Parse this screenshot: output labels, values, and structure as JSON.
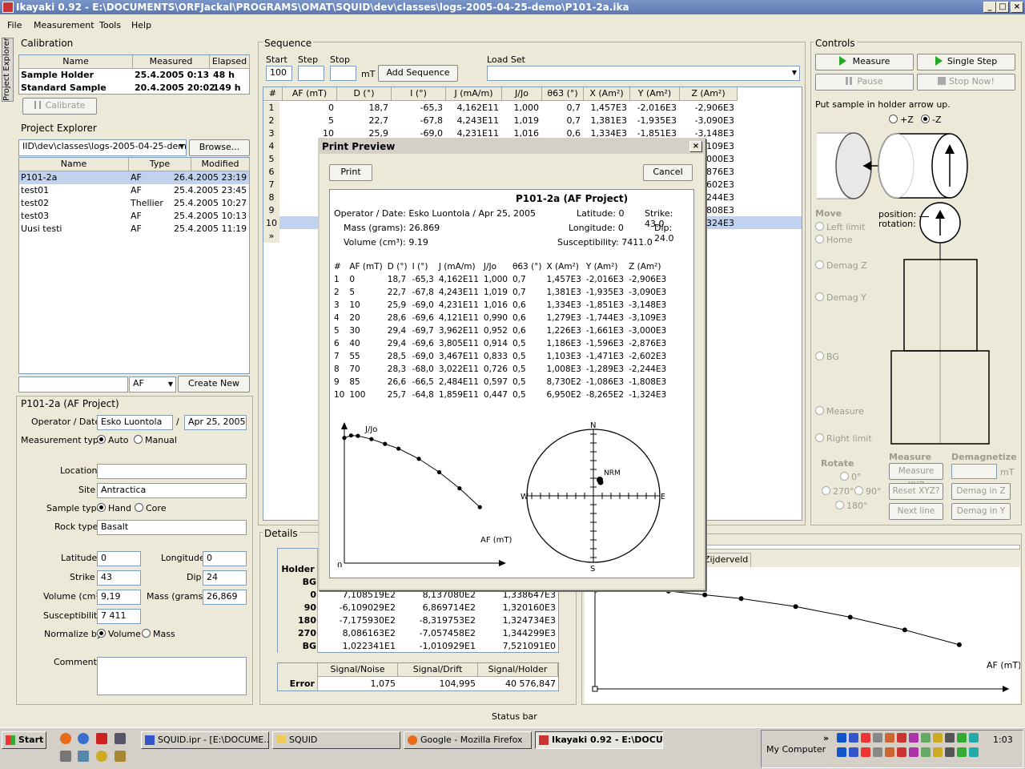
{
  "window": {
    "title": "Ikayaki 0.92 - E:\\DOCUMENTS\\ORFJackal\\PROGRAMS\\OMAT\\SQUID\\dev\\classes\\logs-2005-04-25-demo\\P101-2a.ika"
  },
  "menu": [
    "File",
    "Measurement",
    "Tools",
    "Help"
  ],
  "side_tab": "Project Explorer",
  "calibration": {
    "title": "Calibration",
    "headers": [
      "Name",
      "Measured",
      "Elapsed"
    ],
    "rows": [
      [
        "Sample Holder",
        "25.4.2005 0:13",
        "48 h"
      ],
      [
        "Standard Sample",
        "20.4.2005 20:02",
        "149 h"
      ]
    ],
    "calibrate_label": "Calibrate"
  },
  "explorer": {
    "title": "Project Explorer",
    "path": "IID\\dev\\classes\\logs-2005-04-25-demo",
    "browse_label": "Browse...",
    "headers": [
      "Name",
      "Type",
      "Modified"
    ],
    "rows": [
      [
        "P101-2a",
        "AF",
        "26.4.2005 23:19"
      ],
      [
        "test01",
        "AF",
        "25.4.2005 23:45"
      ],
      [
        "test02",
        "Thellier",
        "25.4.2005 10:27"
      ],
      [
        "test03",
        "AF",
        "25.4.2005 10:13"
      ],
      [
        "Uusi testi",
        "AF",
        "25.4.2005 11:19"
      ]
    ],
    "new_type": "AF",
    "create_label": "Create New"
  },
  "project": {
    "title": "P101-2a (AF Project)",
    "operator_label": "Operator / Date",
    "operator": "Esko Luontola",
    "slash": "/",
    "date": "Apr 25, 2005",
    "mtype_label": "Measurement type",
    "auto": "Auto",
    "manual": "Manual",
    "location_label": "Location",
    "location": "",
    "site_label": "Site",
    "site": "Antractica",
    "stype_label": "Sample type",
    "hand": "Hand",
    "core": "Core",
    "rock_label": "Rock type",
    "rock": "Basalt",
    "lat_label": "Latitude",
    "lat": "0",
    "lon_label": "Longitude",
    "lon": "0",
    "strike_label": "Strike",
    "strike": "43",
    "dip_label": "Dip",
    "dip": "24",
    "vol_label": "Volume (cm³)",
    "vol": "9,19",
    "mass_label": "Mass (grams)",
    "mass": "26,869",
    "sus_label": "Susceptibility",
    "sus": "7 411",
    "norm_label": "Normalize by",
    "volume": "Volume",
    "mass_opt": "Mass",
    "comments_label": "Comments"
  },
  "sequence": {
    "title": "Sequence",
    "start_label": "Start",
    "start": "100",
    "step_label": "Step",
    "stop_label": "Stop",
    "unit": "mT",
    "add_label": "Add Sequence",
    "loadset_label": "Load Set",
    "headers": [
      "#",
      "AF (mT)",
      "D (°)",
      "I (°)",
      "J (mA/m)",
      "J/Jo",
      "θ63 (°)",
      "X (Am²)",
      "Y (Am²)",
      "Z (Am²)"
    ],
    "rows": [
      [
        "1",
        "0",
        "18,7",
        "-65,3",
        "4,162E11",
        "1,000",
        "0,7",
        "1,457E3",
        "-2,016E3",
        "-2,906E3"
      ],
      [
        "2",
        "5",
        "22,7",
        "-67,8",
        "4,243E11",
        "1,019",
        "0,7",
        "1,381E3",
        "-1,935E3",
        "-3,090E3"
      ],
      [
        "3",
        "10",
        "25,9",
        "-69,0",
        "4,231E11",
        "1,016",
        "0,6",
        "1,334E3",
        "-1,851E3",
        "-3,148E3"
      ],
      [
        "4",
        "",
        "",
        "",
        "",
        "",
        "",
        "",
        "-1,744E3",
        "-3,109E3"
      ],
      [
        "5",
        "",
        "",
        "",
        "",
        "",
        "",
        "",
        "-1,661E3",
        "-3,000E3"
      ],
      [
        "6",
        "",
        "",
        "",
        "",
        "",
        "",
        "",
        "-1,596E3",
        "-2,876E3"
      ],
      [
        "7",
        "",
        "",
        "",
        "",
        "",
        "",
        "",
        "-1,471E3",
        "-2,602E3"
      ],
      [
        "8",
        "",
        "",
        "",
        "",
        "",
        "",
        "",
        "-1,289E3",
        "-2,244E3"
      ],
      [
        "9",
        "",
        "",
        "",
        "",
        "",
        "",
        "",
        "-1,086E3",
        "-1,808E3"
      ],
      [
        "10",
        "",
        "",
        "",
        "",
        "",
        "",
        "",
        "-8,265E2",
        "-1,324E3"
      ],
      [
        "»",
        "",
        "",
        "",
        "",
        "",
        "",
        "",
        "",
        ""
      ]
    ]
  },
  "controls": {
    "title": "Controls",
    "measure": "Measure",
    "single_step": "Single Step",
    "pause": "Pause",
    "stop_now": "Stop Now!",
    "instruction": "Put sample in holder arrow up.",
    "plus_z": "+Z",
    "minus_z": "-Z",
    "move_label": "Move",
    "left_limit": "Left limit",
    "home": "Home",
    "demag_z": "Demag Z",
    "demag_y": "Demag Y",
    "bg": "BG",
    "measure_pos": "Measure",
    "right_limit": "Right limit",
    "position_label": "position:",
    "rotation_label": "rotation:",
    "rotate_label": "Rotate",
    "r0": "0°",
    "r270": "270°",
    "r90": "90°",
    "r180": "180°",
    "measure_grp": "Measure",
    "demag_grp": "Demagnetize",
    "measure_xyz": "Measure XYZ",
    "mt": "mT",
    "reset_xyz": "Reset XYZ?",
    "demag_in_z": "Demag in Z",
    "next_line": "Next line",
    "demag_in_y": "Demag in Y"
  },
  "details": {
    "title": "Details",
    "holder": "Holder",
    "rows": [
      [
        "BG",
        "",
        "",
        ""
      ],
      [
        "0",
        "7,108519E2",
        "8,137080E2",
        "1,338647E3"
      ],
      [
        "90",
        "-6,109029E2",
        "6,869714E2",
        "1,320160E3"
      ],
      [
        "180",
        "-7,175930E2",
        "-8,319753E2",
        "1,324734E3"
      ],
      [
        "270",
        "8,086163E2",
        "-7,057458E2",
        "1,344299E3"
      ],
      [
        "BG",
        "1,022341E1",
        "-1,010929E1",
        "7,521091E0"
      ]
    ],
    "err_headers": [
      "Signal/Noise",
      "Signal/Drift",
      "Signal/Holder"
    ],
    "err_label": "Error",
    "err": [
      "1,075",
      "104,995",
      "40 576,847"
    ]
  },
  "plot_tab": "Zijderveld",
  "plot_xlabel": "AF (mT)",
  "status": "Status bar",
  "dialog": {
    "title": "Print Preview",
    "print": "Print",
    "cancel": "Cancel",
    "heading": "P101-2a (AF Project)",
    "info": {
      "op": "Operator / Date: Esko Luontola / Apr 25, 2005",
      "lat": "Latitude: 0",
      "strike": "Strike: 43.0",
      "mass": "Mass (grams): 26.869",
      "lon": "Longitude: 0",
      "dip": "Dip: 24.0",
      "vol": "Volume (cm³): 9.19",
      "sus": "Susceptibility: 7411.0"
    },
    "headers": [
      "#",
      "AF (mT)",
      "D (°)",
      "I (°)",
      "J (mA/m)",
      "J/Jo",
      "θ63 (°)",
      "X (Am²)",
      "Y (Am²)",
      "Z (Am²)"
    ],
    "rows": [
      [
        "1",
        "0",
        "18,7",
        "-65,3",
        "4,162E11",
        "1,000",
        "0,7",
        "1,457E3",
        "-2,016E3",
        "-2,906E3"
      ],
      [
        "2",
        "5",
        "22,7",
        "-67,8",
        "4,243E11",
        "1,019",
        "0,7",
        "1,381E3",
        "-1,935E3",
        "-3,090E3"
      ],
      [
        "3",
        "10",
        "25,9",
        "-69,0",
        "4,231E11",
        "1,016",
        "0,6",
        "1,334E3",
        "-1,851E3",
        "-3,148E3"
      ],
      [
        "4",
        "20",
        "28,6",
        "-69,6",
        "4,121E11",
        "0,990",
        "0,6",
        "1,279E3",
        "-1,744E3",
        "-3,109E3"
      ],
      [
        "5",
        "30",
        "29,4",
        "-69,7",
        "3,962E11",
        "0,952",
        "0,6",
        "1,226E3",
        "-1,661E3",
        "-3,000E3"
      ],
      [
        "6",
        "40",
        "29,4",
        "-69,6",
        "3,805E11",
        "0,914",
        "0,5",
        "1,186E3",
        "-1,596E3",
        "-2,876E3"
      ],
      [
        "7",
        "55",
        "28,5",
        "-69,0",
        "3,467E11",
        "0,833",
        "0,5",
        "1,103E3",
        "-1,471E3",
        "-2,602E3"
      ],
      [
        "8",
        "70",
        "28,3",
        "-68,0",
        "3,022E11",
        "0,726",
        "0,5",
        "1,008E3",
        "-1,289E3",
        "-2,244E3"
      ],
      [
        "9",
        "85",
        "26,6",
        "-66,5",
        "2,484E11",
        "0,597",
        "0,5",
        "8,730E2",
        "-1,086E3",
        "-1,808E3"
      ],
      [
        "10",
        "100",
        "25,7",
        "-64,8",
        "1,859E11",
        "0,447",
        "0,5",
        "6,950E2",
        "-8,265E2",
        "-1,324E3"
      ]
    ],
    "plot_ylabel": "J/Jo",
    "plot_xlabel": "AF (mT)",
    "plot_origin": "0",
    "compass": {
      "n": "N",
      "e": "E",
      "s": "S",
      "w": "W",
      "nrm": "NRM"
    }
  },
  "chart_data": [
    {
      "type": "line",
      "title": "",
      "xlabel": "AF (mT)",
      "ylabel": "J/Jo",
      "x": [
        0,
        5,
        10,
        20,
        30,
        40,
        55,
        70,
        85,
        100
      ],
      "series": [
        {
          "values": [
            1.0,
            1.019,
            1.016,
            0.99,
            0.952,
            0.914,
            0.833,
            0.726,
            0.597,
            0.447
          ]
        }
      ],
      "xlim": [
        0,
        130
      ],
      "ylim": [
        0,
        1.1
      ]
    },
    {
      "type": "line",
      "title": "",
      "xlabel": "AF (mT)",
      "ylabel": "",
      "x": [
        0,
        5,
        10,
        20,
        30,
        40,
        55,
        70,
        85,
        100
      ],
      "series": [
        {
          "values": [
            1.0,
            1.019,
            1.016,
            0.99,
            0.952,
            0.914,
            0.833,
            0.726,
            0.597,
            0.447
          ]
        }
      ],
      "xlim": [
        0,
        115
      ],
      "ylim": [
        0,
        1.03
      ]
    }
  ],
  "taskbar": {
    "start": "Start",
    "tasks": [
      "SQUID.ipr - [E:\\DOCUME...",
      "SQUID",
      "Google - Mozilla Firefox",
      "Ikayaki 0.92 - E:\\DOCU..."
    ],
    "my_computer": "My Computer",
    "clock": "1:03"
  }
}
